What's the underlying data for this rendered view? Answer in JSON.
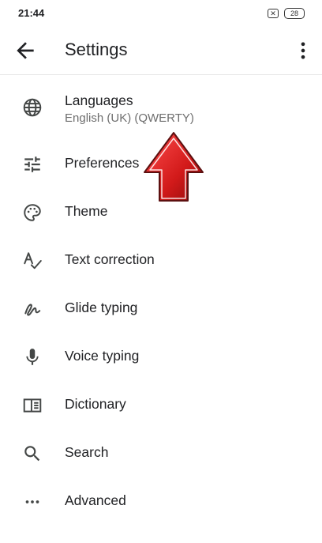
{
  "status_bar": {
    "time": "21:44",
    "x_icon_glyph": "✕",
    "battery": "28"
  },
  "app_bar": {
    "back_icon": "arrow-back-icon",
    "title": "Settings",
    "overflow_icon": "more-vert-icon"
  },
  "items": [
    {
      "label": "Languages",
      "summary": "English (UK) (QWERTY)",
      "icon": "globe-icon"
    },
    {
      "label": "Preferences",
      "icon": "tune-sliders-icon"
    },
    {
      "label": "Theme",
      "icon": "palette-icon"
    },
    {
      "label": "Text correction",
      "icon": "spellcheck-icon"
    },
    {
      "label": "Glide typing",
      "icon": "gesture-icon"
    },
    {
      "label": "Voice typing",
      "icon": "microphone-icon"
    },
    {
      "label": "Dictionary",
      "icon": "book-icon"
    },
    {
      "label": "Search",
      "icon": "search-icon"
    },
    {
      "label": "Advanced",
      "icon": "more-horiz-icon"
    }
  ],
  "overlay": {
    "arrow_icon": "red-up-arrow-icon",
    "arrow_color": "#d21a1a"
  },
  "colors": {
    "text_primary": "#202124",
    "text_secondary": "#6e6e6e",
    "icon": "#444746"
  }
}
